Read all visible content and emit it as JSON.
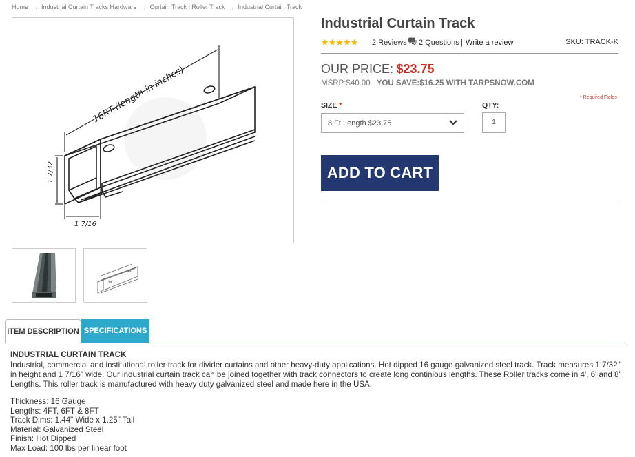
{
  "breadcrumb": [
    "Home",
    "Industrial Curtain Tracks Hardware",
    "Curtain Track | Roller Track",
    "Industrial Curtain Track"
  ],
  "image": {
    "dimension_label": "16RT-(length in inches)",
    "height_label": "1 7/32",
    "width_label": "1 7/16"
  },
  "product": {
    "title": "Industrial Curtain Track",
    "stars": "★★★★★",
    "reviews": "2 Reviews",
    "questions": "2 Questions",
    "separator": "|",
    "write_review": "Write a review",
    "sku": "SKU: TRACK-K",
    "price_label": "OUR PRICE:",
    "price": "$23.75",
    "msrp_label": "MSRP:",
    "msrp": "$40.00",
    "you_save": "YOU SAVE:$16.25 WITH TARPSNOW.COM",
    "required_fields": "* Required Fields",
    "size_label": "SIZE",
    "required_star": "*",
    "size_value": "8 Ft Length $23.75",
    "qty_label": "QTY:",
    "qty_value": "1",
    "add_to_cart": "ADD TO CART"
  },
  "tabs": {
    "description": "ITEM DESCRIPTION",
    "specifications": "SPECIFICATIONS"
  },
  "description": {
    "title": "INDUSTRIAL CURTAIN TRACK",
    "body": "Industrial, commercial and institutional roller track for divider curtains and other heavy-duty applications. Hot dipped 16 gauge galvanized steel track. Track measures 1 7/32\" in height and 1 7/16\" wide. Our industrial curtain track can be joined together with track connectors to create long continious lengths. These Roller tracks come in 4', 6' and 8' Lengths. This roller track is manufactured with heavy duty galvanized steel and made here in the USA.",
    "specs": [
      "Thickness:  16 Gauge",
      "Lengths:  4FT, 6FT & 8FT",
      "Track Dims:  1.44\" Wide x 1.25\" Tall",
      "Material:  Galvanized Steel",
      "Finish:  Hot Dipped",
      "Max Load:  100 lbs per linear foot"
    ]
  },
  "icons": {
    "breadcrumb_separator": "arrow-right-icon",
    "questions": "chat-bubble-icon",
    "select": "chevron-down-icon"
  },
  "colors": {
    "price": "#d42a1d",
    "button": "#233870",
    "active_tab_accent": "#2daacb",
    "stars": "#f5b800"
  }
}
